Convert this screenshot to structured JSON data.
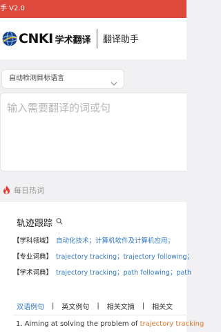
{
  "status_bar": {
    "text": "手 V2.0"
  },
  "header": {
    "logo_text": "CNKI",
    "logo_cn": "学术翻译",
    "title": "翻译助手"
  },
  "lang_select": {
    "value": "自动检测目标语言",
    "icon": "chevron-down-icon"
  },
  "input": {
    "placeholder": "输入需要翻译的词或句"
  },
  "hot": {
    "label": "每日热词",
    "icon": "flame-icon"
  },
  "card": {
    "term": "轨迹跟踪",
    "rows": [
      {
        "key": "【学科领域】",
        "value": "自动化技术；计算机软件及计算机应用；"
      },
      {
        "key": "【专业词典】",
        "value": "trajectory tracking；trajectory following；"
      },
      {
        "key": "【学术词典】",
        "value": "trajectory tracking；path following；path"
      }
    ],
    "tabs": [
      "双语例句",
      "英文例句",
      "相关文摘",
      "相关文"
    ],
    "separator": "|",
    "example": {
      "prefix": "1. Aiming at solving the problem of ",
      "highlight": "trajectory tracking"
    }
  },
  "colors": {
    "brand_red": "#dd4a3d",
    "link_blue": "#3279c4",
    "highlight_orange": "#e4762a"
  }
}
